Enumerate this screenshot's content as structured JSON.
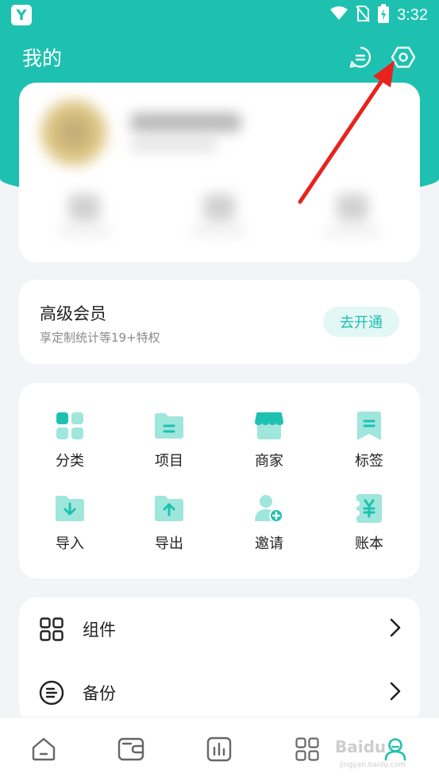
{
  "status_bar": {
    "time": "3:32"
  },
  "header": {
    "title": "我的"
  },
  "membership": {
    "title": "高级会员",
    "subtitle": "享定制统计等19+特权",
    "button": "去开通"
  },
  "grid": [
    {
      "label": "分类",
      "icon": "category-icon"
    },
    {
      "label": "项目",
      "icon": "project-folder-icon"
    },
    {
      "label": "商家",
      "icon": "store-icon"
    },
    {
      "label": "标签",
      "icon": "tag-icon"
    },
    {
      "label": "导入",
      "icon": "import-icon"
    },
    {
      "label": "导出",
      "icon": "export-icon"
    },
    {
      "label": "邀请",
      "icon": "invite-user-icon"
    },
    {
      "label": "账本",
      "icon": "ledger-icon"
    }
  ],
  "list": [
    {
      "label": "组件",
      "icon": "widget-grid-icon"
    },
    {
      "label": "备份",
      "icon": "backup-icon"
    }
  ],
  "bottom_nav": [
    "home-icon",
    "wallet-icon",
    "chart-icon",
    "apps-grid-icon",
    "profile-icon"
  ],
  "watermark": {
    "text": "Baidu",
    "sub": "jingyan.baidu.com"
  },
  "colors": {
    "accent": "#1ec1b0",
    "accent_light": "#9fe6dc",
    "background": "#f2f4f8",
    "annotation": "#e8231f"
  }
}
